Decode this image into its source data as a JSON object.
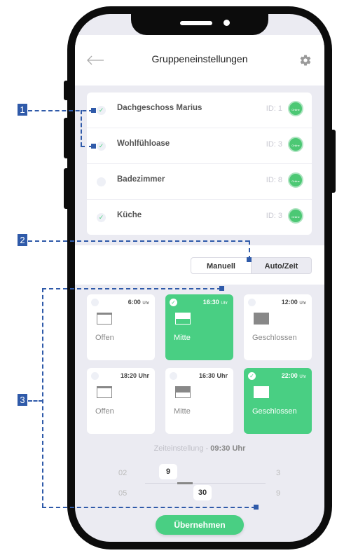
{
  "header": {
    "title": "Gruppeneinstellungen",
    "back_icon": "arrow-left-icon",
    "settings_icon": "gear-icon"
  },
  "groups": [
    {
      "name": "Dachgeschoss Marius",
      "id": "ID: 1",
      "checked": true,
      "status": "Online"
    },
    {
      "name": "Wohlfühloase",
      "id": "ID: 3",
      "checked": true,
      "status": "Online"
    },
    {
      "name": "Badezimmer",
      "id": "ID: 8",
      "checked": false,
      "status": "Online"
    },
    {
      "name": "Küche",
      "id": "ID: 3",
      "checked": true,
      "status": "Online"
    }
  ],
  "mode": {
    "manual": "Manuell",
    "auto": "Auto/Zeit",
    "selected": "auto"
  },
  "schedules": [
    {
      "time": "6:00",
      "unit": "Uhr",
      "label": "Offen",
      "selected": false,
      "level": 0.15
    },
    {
      "time": "16:30",
      "unit": "Uhr",
      "label": "Mitte",
      "selected": true,
      "level": 0.5
    },
    {
      "time": "12:00",
      "unit": "Uhr",
      "label": "Geschlossen",
      "selected": false,
      "level": 1.0
    },
    {
      "time": "18:20 Uhr",
      "unit": "",
      "label": "Offen",
      "selected": false,
      "level": 0.15
    },
    {
      "time": "16:30 Uhr",
      "unit": "",
      "label": "Mitte",
      "selected": false,
      "level": 0.5
    },
    {
      "time": "22:00",
      "unit": "Uhr",
      "label": "Geschlossen",
      "selected": true,
      "level": 1.0
    }
  ],
  "time_setting": {
    "label": "Zeiteinstellung - ",
    "value": "09:30 Uhr"
  },
  "picker": {
    "hours": {
      "above": "02",
      "selected": "9",
      "below": "05"
    },
    "minutes": {
      "selected": "30"
    },
    "right": {
      "above": "3",
      "below": "9"
    }
  },
  "apply_label": "Übernehmen",
  "annotations": [
    "1",
    "2",
    "3"
  ],
  "colors": {
    "accent": "#49cf83",
    "annotation": "#2f5aa9",
    "background": "#ebebf2"
  }
}
